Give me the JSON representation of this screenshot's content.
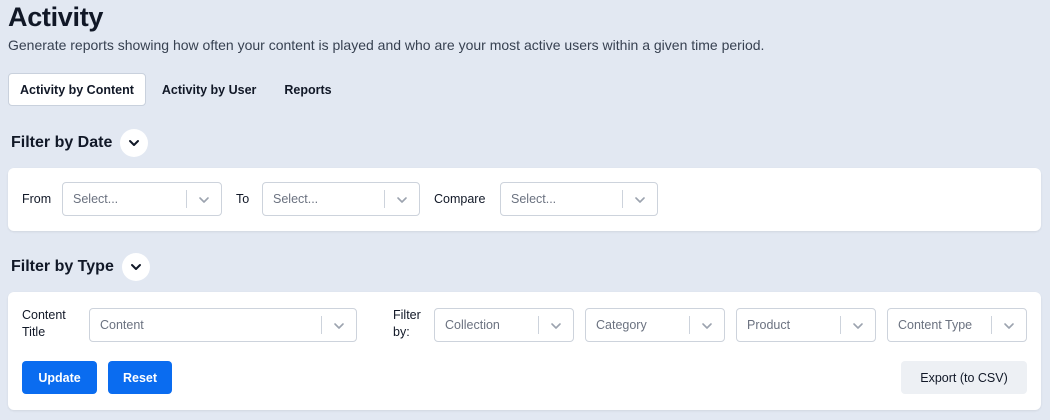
{
  "header": {
    "title": "Activity",
    "subtitle": "Generate reports showing how often your content is played and who are your most active users within a given time period."
  },
  "tabs": [
    {
      "label": "Activity by Content",
      "active": true
    },
    {
      "label": "Activity by User",
      "active": false
    },
    {
      "label": "Reports",
      "active": false
    }
  ],
  "date_filter": {
    "title": "Filter by Date",
    "from_label": "From",
    "from_placeholder": "Select...",
    "to_label": "To",
    "to_placeholder": "Select...",
    "compare_label": "Compare",
    "compare_placeholder": "Select..."
  },
  "type_filter": {
    "title": "Filter by Type",
    "content_title_label_line1": "Content",
    "content_title_label_line2": "Title",
    "content_placeholder": "Content",
    "filter_by_label_line1": "Filter",
    "filter_by_label_line2": "by:",
    "collection_placeholder": "Collection",
    "category_placeholder": "Category",
    "product_placeholder": "Product",
    "content_type_placeholder": "Content Type"
  },
  "actions": {
    "update_label": "Update",
    "reset_label": "Reset",
    "export_label": "Export (to CSV)"
  },
  "icons": {
    "collapse": "chevron-down-icon",
    "dropdown": "chevron-down-icon"
  },
  "colors": {
    "background": "#e2e8f2",
    "primary": "#0a6cf0",
    "secondary_button": "#edf0f4"
  }
}
